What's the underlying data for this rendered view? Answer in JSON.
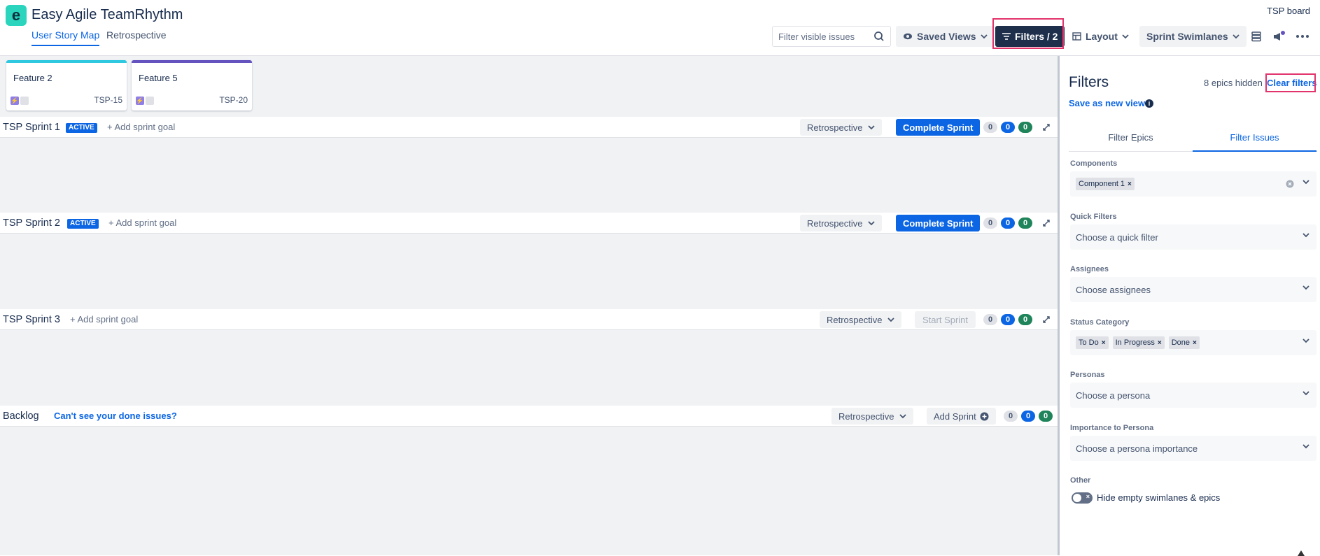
{
  "app": {
    "title": "Easy Agile TeamRhythm",
    "board": "TSP board",
    "tabs": [
      {
        "label": "User Story Map"
      },
      {
        "label": "Retrospective"
      }
    ]
  },
  "toolbar": {
    "search_placeholder": "Filter visible issues",
    "saved_views": "Saved Views",
    "filters": "Filters / 2",
    "layout": "Layout",
    "swimlanes": "Sprint Swimlanes"
  },
  "features": [
    {
      "title": "Feature 2",
      "key": "TSP-15",
      "color": "#2ec8e0"
    },
    {
      "title": "Feature 5",
      "key": "TSP-20",
      "color": "#6554c0"
    }
  ],
  "sprints": [
    {
      "name": "TSP Sprint 1",
      "badge": "ACTIVE",
      "goal": "Add sprint goal",
      "retro": "Retrospective",
      "action": "Complete Sprint",
      "counts": [
        "0",
        "0",
        "0"
      ]
    },
    {
      "name": "TSP Sprint 2",
      "badge": "ACTIVE",
      "goal": "Add sprint goal",
      "retro": "Retrospective",
      "action": "Complete Sprint",
      "counts": [
        "0",
        "0",
        "0"
      ]
    },
    {
      "name": "TSP Sprint 3",
      "goal": "Add sprint goal",
      "retro": "Retrospective",
      "action": "Start Sprint",
      "counts": [
        "0",
        "0",
        "0"
      ]
    }
  ],
  "backlog": {
    "name": "Backlog",
    "link": "Can't see your done issues?",
    "retro": "Retrospective",
    "action": "Add Sprint",
    "counts": [
      "0",
      "0",
      "0"
    ]
  },
  "panel": {
    "title": "Filters",
    "hidden": "8 epics hidden",
    "clear": "Clear filters",
    "save": "Save as new view",
    "tabs": [
      "Filter Epics",
      "Filter Issues"
    ],
    "components": {
      "label": "Components",
      "chips": [
        "Component 1"
      ]
    },
    "quick_filters": {
      "label": "Quick Filters",
      "placeholder": "Choose a quick filter"
    },
    "assignees": {
      "label": "Assignees",
      "placeholder": "Choose assignees"
    },
    "status_category": {
      "label": "Status Category",
      "chips": [
        "To Do",
        "In Progress",
        "Done"
      ]
    },
    "personas": {
      "label": "Personas",
      "placeholder": "Choose a persona"
    },
    "importance": {
      "label": "Importance to Persona",
      "placeholder": "Choose a persona importance"
    },
    "other": {
      "label": "Other",
      "toggle_label": "Hide empty swimlanes & epics"
    }
  },
  "icons": {
    "logo": "easy-agile-logo",
    "search": "search-icon",
    "eye": "eye-icon",
    "filter": "filter-icon",
    "layout": "layout-icon",
    "chevron": "chevron-down-icon",
    "stack": "stack-icon",
    "megaphone": "megaphone-icon",
    "more": "more-icon",
    "collapse": "collapse-icon",
    "plus": "plus-icon",
    "info": "info-icon"
  },
  "colors": {
    "primary": "#0c66e4",
    "dark_button": "#1d2f4b",
    "highlight": "#e2336b",
    "green": "#1f845a"
  }
}
